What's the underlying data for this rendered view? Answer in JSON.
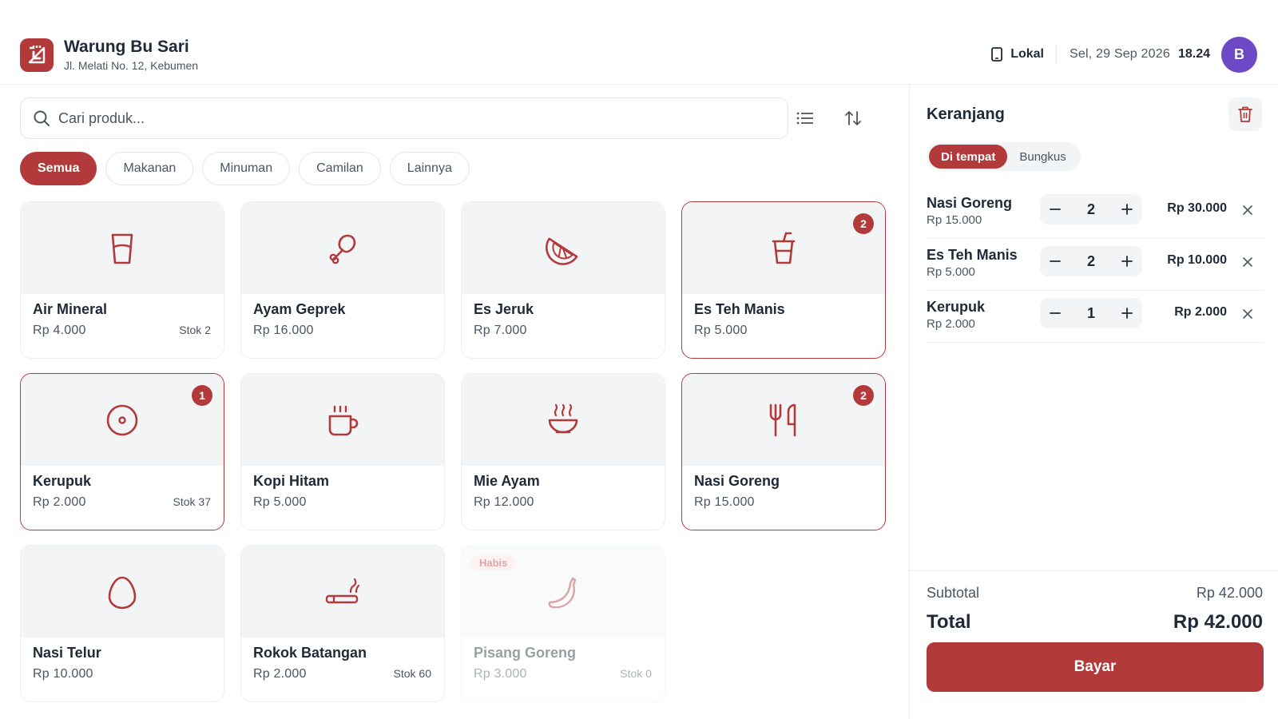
{
  "status_bar": {
    "icons": [
      "signal-icon",
      "wifi-icon",
      "battery-icon"
    ]
  },
  "header": {
    "store_name": "Warung Bu Sari",
    "store_address": "Jl. Melati No. 12, Kebumen",
    "mode_label": "Lokal",
    "date": "Sel, 29 Sep 2026",
    "time": "18.24",
    "avatar_initial": "B"
  },
  "search": {
    "placeholder": "Cari produk..."
  },
  "categories": [
    {
      "label": "Semua",
      "active": true
    },
    {
      "label": "Makanan",
      "active": false
    },
    {
      "label": "Minuman",
      "active": false
    },
    {
      "label": "Camilan",
      "active": false
    },
    {
      "label": "Lainnya",
      "active": false
    }
  ],
  "products": [
    {
      "name": "Air Mineral",
      "price": "Rp 4.000",
      "stock": "Stok 2",
      "icon": "glass-icon",
      "badge": ""
    },
    {
      "name": "Ayam Geprek",
      "price": "Rp 16.000",
      "stock": "",
      "icon": "drumstick-icon",
      "badge": ""
    },
    {
      "name": "Es Jeruk",
      "price": "Rp 7.000",
      "stock": "",
      "icon": "citrus-icon",
      "badge": ""
    },
    {
      "name": "Es Teh Manis",
      "price": "Rp 5.000",
      "stock": "",
      "icon": "cup-straw-icon",
      "badge": "2"
    },
    {
      "name": "Kerupuk",
      "price": "Rp 2.000",
      "stock": "Stok 37",
      "icon": "disc-icon",
      "badge": "1"
    },
    {
      "name": "Kopi Hitam",
      "price": "Rp 5.000",
      "stock": "",
      "icon": "coffee-icon",
      "badge": ""
    },
    {
      "name": "Mie Ayam",
      "price": "Rp 12.000",
      "stock": "",
      "icon": "soup-bowl-icon",
      "badge": ""
    },
    {
      "name": "Nasi Goreng",
      "price": "Rp 15.000",
      "stock": "",
      "icon": "utensils-icon",
      "badge": "2"
    },
    {
      "name": "Nasi Telur",
      "price": "Rp 10.000",
      "stock": "",
      "icon": "egg-icon",
      "badge": ""
    },
    {
      "name": "Rokok Batangan",
      "price": "Rp 2.000",
      "stock": "Stok 60",
      "icon": "cigarette-icon",
      "badge": ""
    },
    {
      "name": "Pisang Goreng",
      "price": "Rp 3.000",
      "stock": "Stok 0",
      "icon": "banana-icon",
      "badge": "",
      "sold_out_label": "Habis"
    }
  ],
  "cart": {
    "title": "Keranjang",
    "order_types": [
      "Di tempat",
      "Bungkus"
    ],
    "active_order_type": "Di tempat",
    "items": [
      {
        "name": "Nasi Goreng",
        "unit_price": "Rp 15.000",
        "qty": "2",
        "total": "Rp 30.000"
      },
      {
        "name": "Es Teh Manis",
        "unit_price": "Rp 5.000",
        "qty": "2",
        "total": "Rp 10.000"
      },
      {
        "name": "Kerupuk",
        "unit_price": "Rp 2.000",
        "qty": "1",
        "total": "Rp 2.000"
      }
    ],
    "subtotal_label": "Subtotal",
    "subtotal": "Rp 42.000",
    "total_label": "Total",
    "total": "Rp 42.000",
    "pay_label": "Bayar"
  },
  "colors": {
    "accent": "#b33a3a",
    "avatar": "#6d49c6",
    "tile_bg": "#f3f4f6"
  }
}
